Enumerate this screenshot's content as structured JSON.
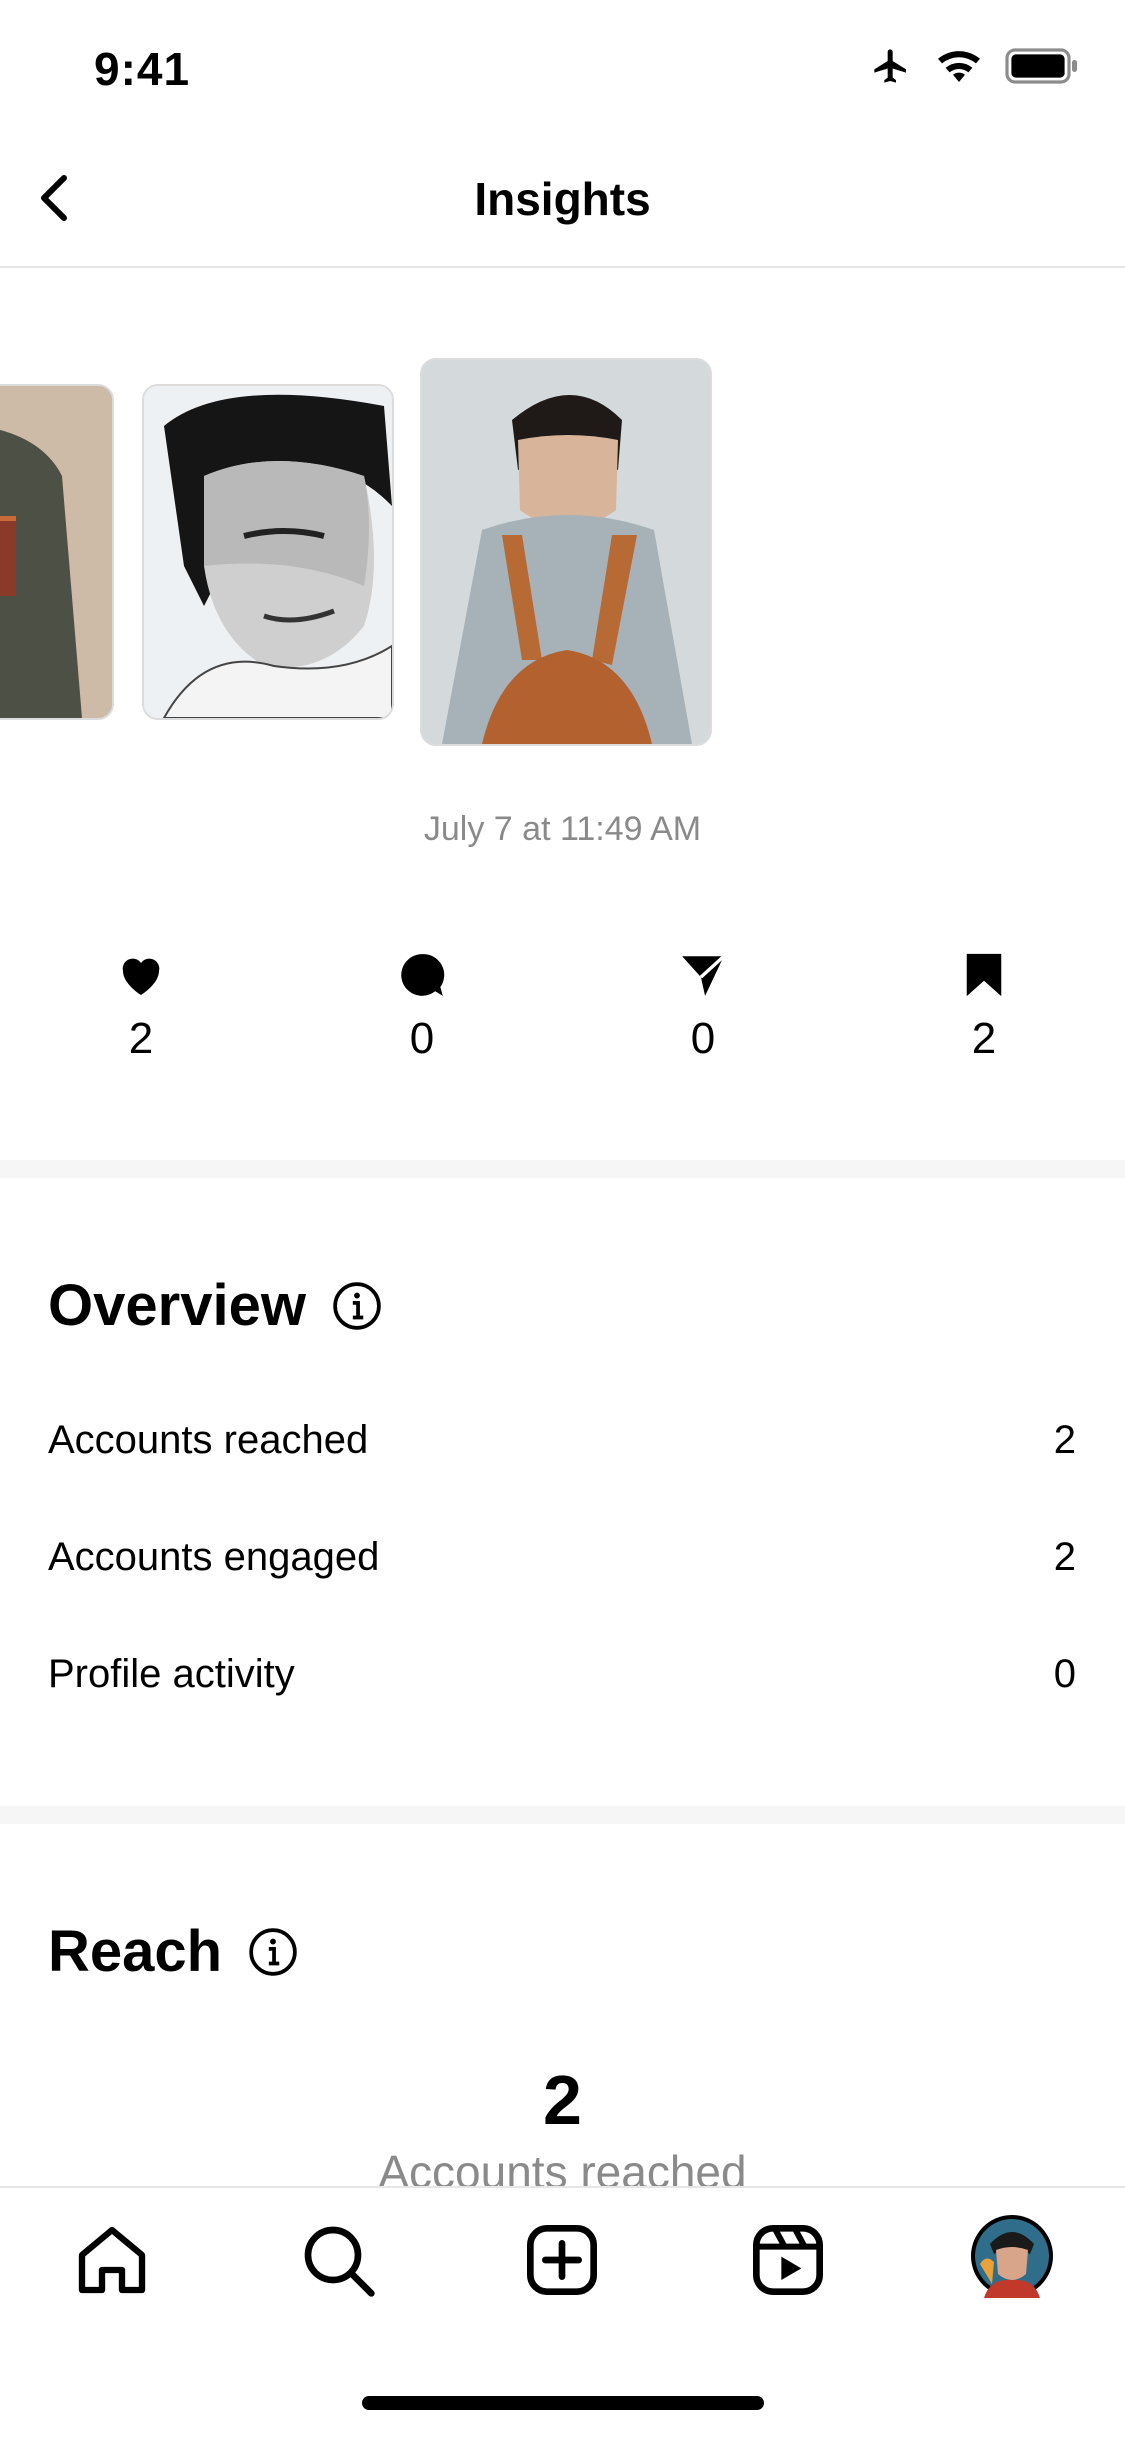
{
  "status_bar": {
    "time": "9:41"
  },
  "header": {
    "title": "Insights"
  },
  "post": {
    "date": "July 7 at 11:49 AM"
  },
  "stats": [
    {
      "icon": "heart-icon",
      "value": "2"
    },
    {
      "icon": "comment-icon",
      "value": "0"
    },
    {
      "icon": "share-icon",
      "value": "0"
    },
    {
      "icon": "bookmark-icon",
      "value": "2"
    }
  ],
  "overview": {
    "title": "Overview",
    "rows": [
      {
        "label": "Accounts reached",
        "value": "2"
      },
      {
        "label": "Accounts engaged",
        "value": "2"
      },
      {
        "label": "Profile activity",
        "value": "0"
      }
    ]
  },
  "reach": {
    "title": "Reach",
    "value": "2",
    "label": "Accounts reached"
  },
  "tab_bar": {
    "items": [
      "home-icon",
      "search-icon",
      "create-icon",
      "reels-icon",
      "profile-avatar"
    ]
  }
}
